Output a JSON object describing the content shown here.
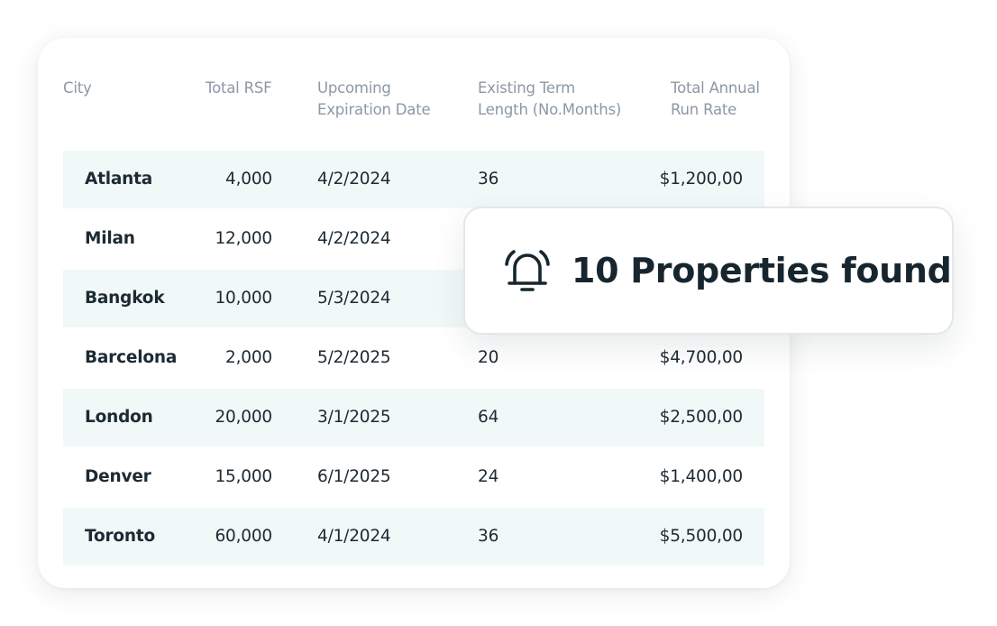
{
  "table": {
    "headers": {
      "city": "City",
      "rsf": "Total RSF",
      "expiration_line1": "Upcoming",
      "expiration_line2": "Expiration Date",
      "term_line1": "Existing Term",
      "term_line2": "Length (No.Months)",
      "rate_line1": "Total Annual",
      "rate_line2": "Run Rate"
    },
    "rows": [
      {
        "city": "Atlanta",
        "rsf": "4,000",
        "expiration": "4/2/2024",
        "term": "36",
        "rate": "$1,200,00"
      },
      {
        "city": "Milan",
        "rsf": "12,000",
        "expiration": "4/2/2024",
        "term": "",
        "rate": ""
      },
      {
        "city": "Bangkok",
        "rsf": "10,000",
        "expiration": "5/3/2024",
        "term": "",
        "rate": ""
      },
      {
        "city": "Barcelona",
        "rsf": "2,000",
        "expiration": "5/2/2025",
        "term": "20",
        "rate": "$4,700,00"
      },
      {
        "city": "London",
        "rsf": "20,000",
        "expiration": "3/1/2025",
        "term": "64",
        "rate": "$2,500,00"
      },
      {
        "city": "Denver",
        "rsf": "15,000",
        "expiration": "6/1/2025",
        "term": "24",
        "rate": "$1,400,00"
      },
      {
        "city": "Toronto",
        "rsf": "60,000",
        "expiration": "4/1/2024",
        "term": "36",
        "rate": "$5,500,00"
      }
    ]
  },
  "notification": {
    "icon": "bell-icon",
    "message": "10 Properties found"
  },
  "colors": {
    "row_stripe": "#f1f9f8",
    "header_text": "#8c98a5",
    "body_text": "#1c2a33"
  }
}
